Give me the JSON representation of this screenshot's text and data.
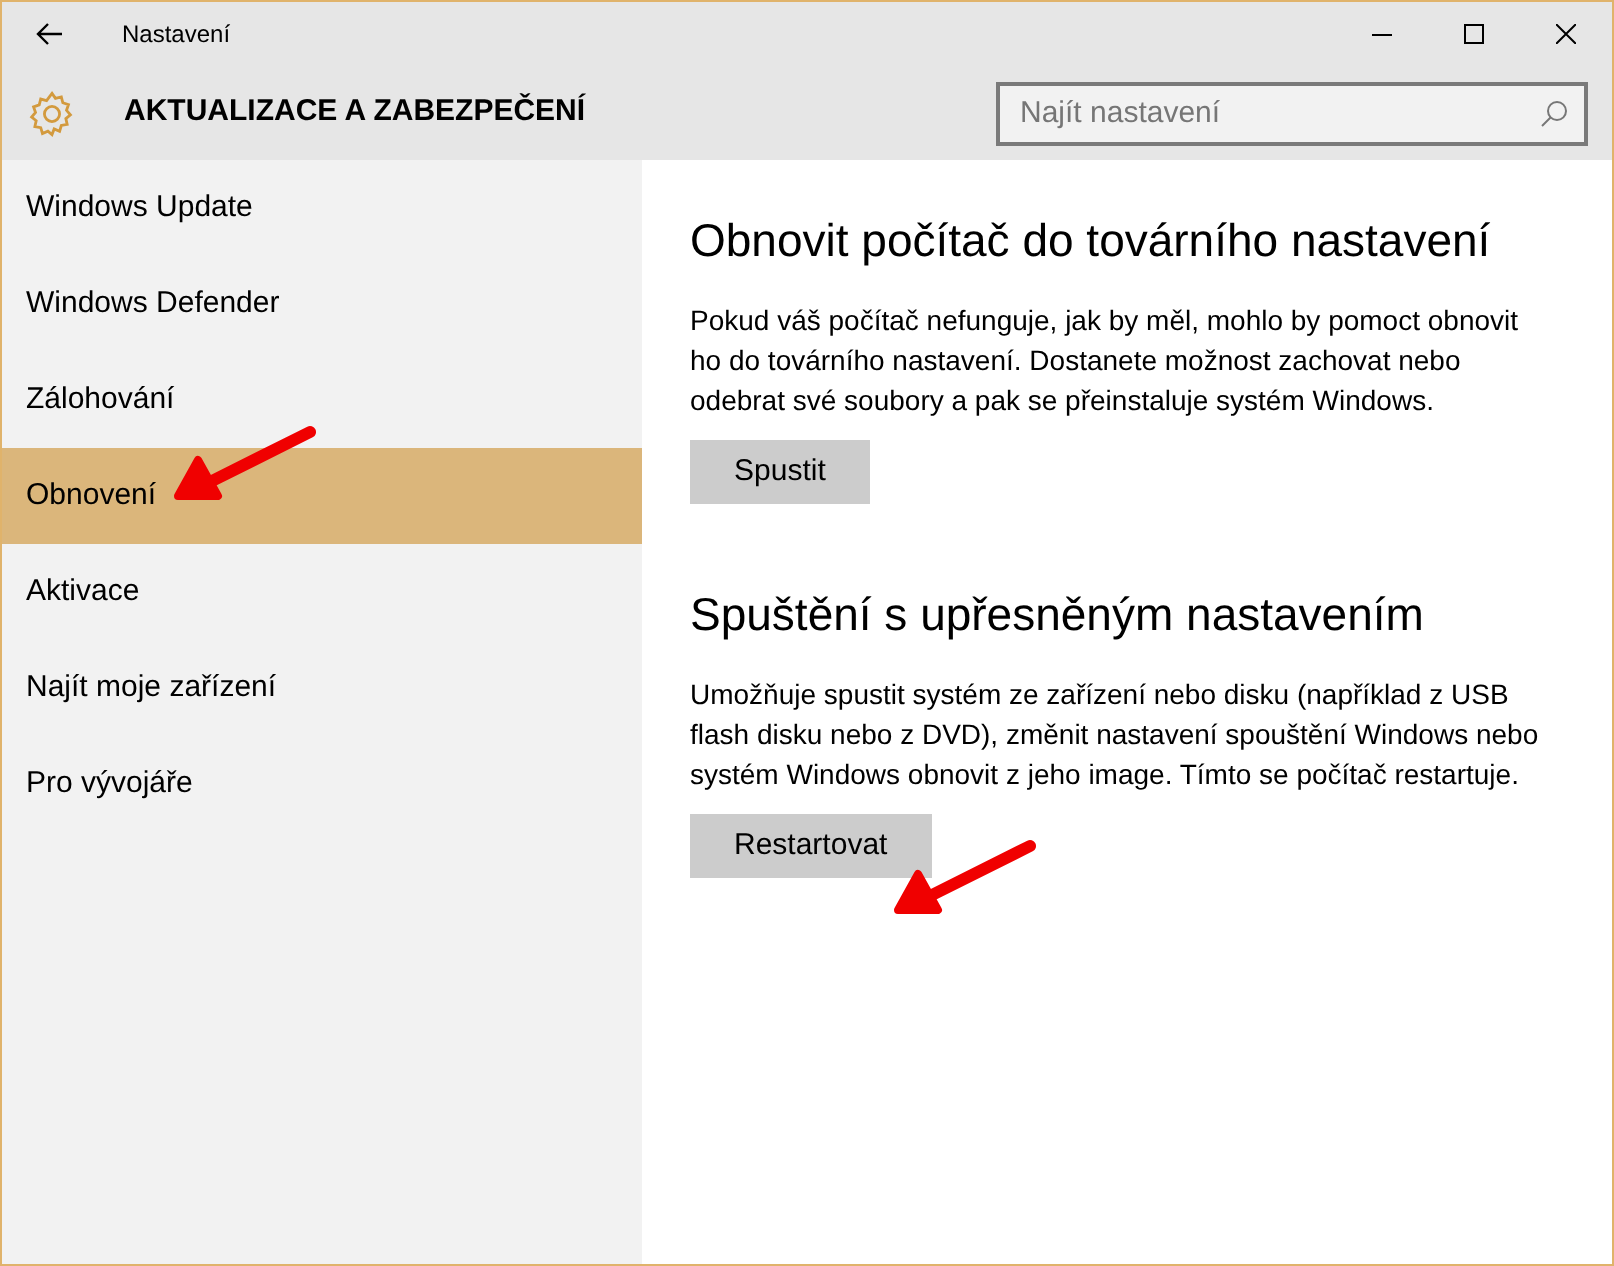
{
  "window": {
    "title": "Nastavení"
  },
  "header": {
    "title": "AKTUALIZACE A ZABEZPEČENÍ"
  },
  "search": {
    "placeholder": "Najít nastavení"
  },
  "sidebar": {
    "items": [
      {
        "label": "Windows Update",
        "selected": false
      },
      {
        "label": "Windows Defender",
        "selected": false
      },
      {
        "label": "Zálohování",
        "selected": false
      },
      {
        "label": "Obnovení",
        "selected": true
      },
      {
        "label": "Aktivace",
        "selected": false
      },
      {
        "label": "Najít moje zařízení",
        "selected": false
      },
      {
        "label": "Pro vývojáře",
        "selected": false
      }
    ]
  },
  "sections": [
    {
      "heading": "Obnovit počítač do továrního nastavení",
      "text": "Pokud váš počítač nefunguje, jak by měl, mohlo by pomoct obnovit ho do továrního nastavení. Dostanete možnost zachovat nebo odebrat své soubory a pak se přeinstaluje systém Windows.",
      "button": "Spustit"
    },
    {
      "heading": "Spuštění s upřesněným nastavením",
      "text": "Umožňuje spustit systém ze zařízení nebo disku (například z USB flash disku nebo z DVD), změnit nastavení spouštění Windows nebo systém Windows obnovit z jeho image. Tímto se počítač restartuje.",
      "button": "Restartovat"
    }
  ]
}
